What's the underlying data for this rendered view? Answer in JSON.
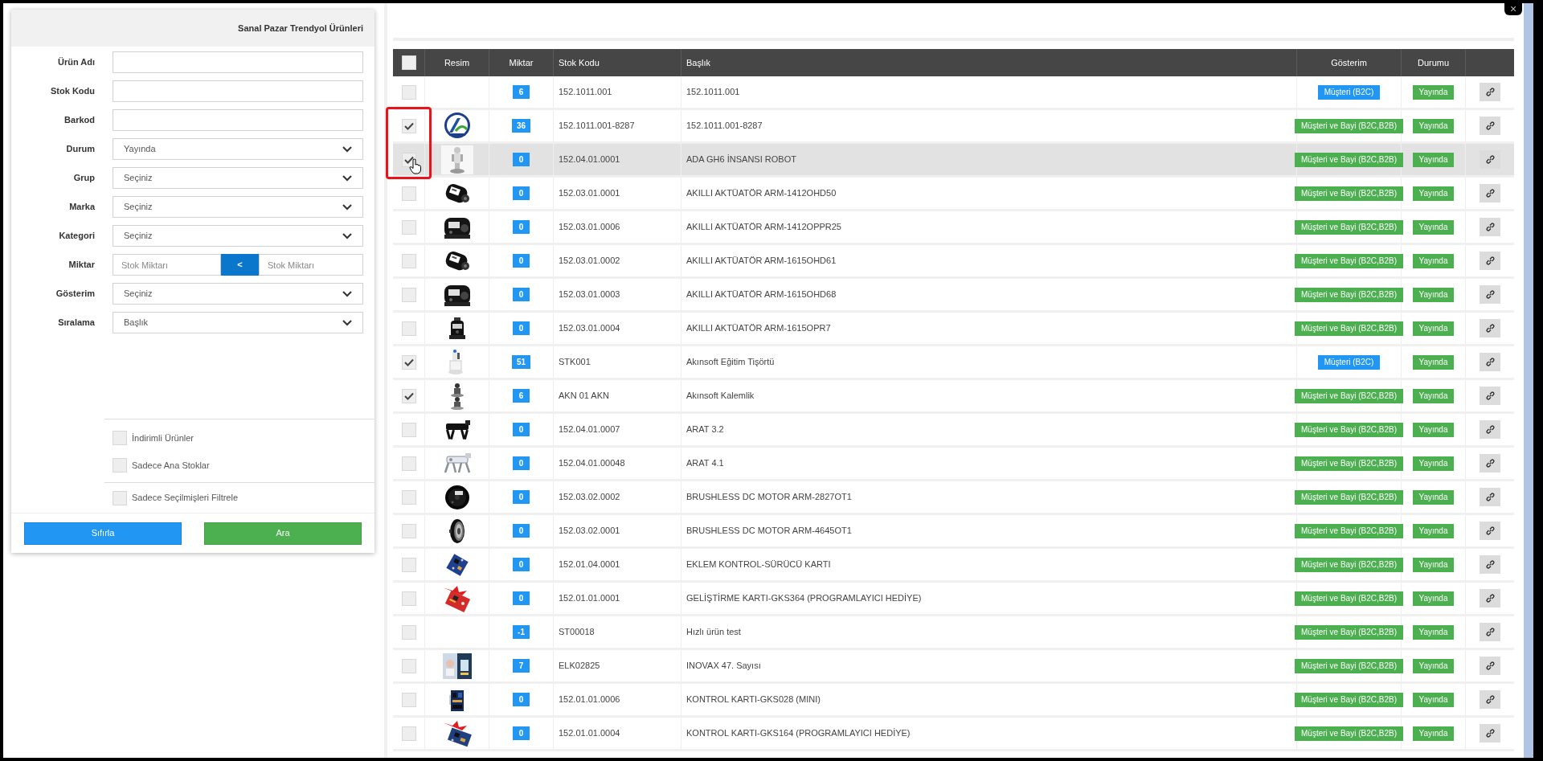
{
  "close_button": "×",
  "filter_panel": {
    "title": "Sanal Pazar Trendyol Ürünleri",
    "fields": [
      {
        "kind": "text",
        "label": "Ürün Adı"
      },
      {
        "kind": "text",
        "label": "Stok Kodu"
      },
      {
        "kind": "text",
        "label": "Barkod"
      },
      {
        "kind": "select",
        "label": "Durum",
        "value": "Yayında"
      },
      {
        "kind": "select",
        "label": "Grup",
        "value": "Seçiniz"
      },
      {
        "kind": "select",
        "label": "Marka",
        "value": "Seçiniz"
      },
      {
        "kind": "select",
        "label": "Kategori",
        "value": "Seçiniz"
      },
      {
        "kind": "range",
        "label": "Miktar",
        "placeholder_from": "Stok Miktarı",
        "operator": "<",
        "placeholder_to": "Stok Miktarı"
      },
      {
        "kind": "select",
        "label": "Gösterim",
        "value": "Seçiniz"
      },
      {
        "kind": "select",
        "label": "Sıralama",
        "value": "Başlık"
      }
    ],
    "options": [
      {
        "label": "İndirimli Ürünler",
        "checked": false
      },
      {
        "label": "Sadece Ana Stoklar",
        "checked": false
      }
    ],
    "selected_filter": {
      "label": "Sadece Seçilmişleri Filtrele",
      "checked": false
    },
    "buttons": [
      {
        "label": "Sıfırla",
        "color": "#2196f3"
      },
      {
        "label": "Ara",
        "color": "#4caf50"
      }
    ]
  },
  "table": {
    "select_all": {
      "checked": false
    },
    "columns": [
      "Resim",
      "Miktar",
      "Stok Kodu",
      "Başlık",
      "Gösterim",
      "Durumu"
    ],
    "rows": [
      {
        "checked": false,
        "hovered": false,
        "highlighted": false,
        "qty": "6",
        "code": "152.1011.001",
        "title": "152.1011.001",
        "display": "Müşteri (B2C)",
        "color": "#2196f3",
        "status": "Yayında"
      },
      {
        "checked": true,
        "hovered": false,
        "highlighted": true,
        "qty": "36",
        "code": "152.1011.001-8287",
        "title": "152.1011.001-8287",
        "display": "Müşteri ve Bayi (B2C,B2B)",
        "color": "#4caf50",
        "status": "Yayında"
      },
      {
        "checked": true,
        "hovered": true,
        "highlighted": true,
        "qty": "0",
        "code": "152.04.01.0001",
        "title": "ADA GH6 İNSANSI ROBOT",
        "display": "Müşteri ve Bayi (B2C,B2B)",
        "color": "#4caf50",
        "status": "Yayında"
      },
      {
        "checked": false,
        "hovered": false,
        "highlighted": false,
        "qty": "0",
        "code": "152.03.01.0001",
        "title": "AKILLI AKTÜATÖR ARM-1412OHD50",
        "display": "Müşteri ve Bayi (B2C,B2B)",
        "color": "#4caf50",
        "status": "Yayında"
      },
      {
        "checked": false,
        "hovered": false,
        "highlighted": false,
        "qty": "0",
        "code": "152.03.01.0006",
        "title": "AKILLI AKTÜATÖR ARM-1412OPPR25",
        "display": "Müşteri ve Bayi (B2C,B2B)",
        "color": "#4caf50",
        "status": "Yayında"
      },
      {
        "checked": false,
        "hovered": false,
        "highlighted": false,
        "qty": "0",
        "code": "152.03.01.0002",
        "title": "AKILLI AKTÜATÖR ARM-1615OHD61",
        "display": "Müşteri ve Bayi (B2C,B2B)",
        "color": "#4caf50",
        "status": "Yayında"
      },
      {
        "checked": false,
        "hovered": false,
        "highlighted": false,
        "qty": "0",
        "code": "152.03.01.0003",
        "title": "AKILLI AKTÜATÖR ARM-1615OHD68",
        "display": "Müşteri ve Bayi (B2C,B2B)",
        "color": "#4caf50",
        "status": "Yayında"
      },
      {
        "checked": false,
        "hovered": false,
        "highlighted": false,
        "qty": "0",
        "code": "152.03.01.0004",
        "title": "AKILLI AKTÜATÖR ARM-1615OPR7",
        "display": "Müşteri ve Bayi (B2C,B2B)",
        "color": "#4caf50",
        "status": "Yayında"
      },
      {
        "checked": true,
        "hovered": false,
        "highlighted": false,
        "qty": "51",
        "code": "STK001",
        "title": "Akınsoft Eğitim Tişörtü",
        "display": "Müşteri (B2C)",
        "color": "#2196f3",
        "status": "Yayında"
      },
      {
        "checked": true,
        "hovered": false,
        "highlighted": false,
        "qty": "6",
        "code": "AKN 01 AKN",
        "title": "Akınsoft Kalemlik",
        "display": "Müşteri ve Bayi (B2C,B2B)",
        "color": "#4caf50",
        "status": "Yayında"
      },
      {
        "checked": false,
        "hovered": false,
        "highlighted": false,
        "qty": "0",
        "code": "152.04.01.0007",
        "title": "ARAT 3.2",
        "display": "Müşteri ve Bayi (B2C,B2B)",
        "color": "#4caf50",
        "status": "Yayında"
      },
      {
        "checked": false,
        "hovered": false,
        "highlighted": false,
        "qty": "0",
        "code": "152.04.01.00048",
        "title": "ARAT 4.1",
        "display": "Müşteri ve Bayi (B2C,B2B)",
        "color": "#4caf50",
        "status": "Yayında"
      },
      {
        "checked": false,
        "hovered": false,
        "highlighted": false,
        "qty": "0",
        "code": "152.03.02.0002",
        "title": "BRUSHLESS DC MOTOR ARM-2827OT1",
        "display": "Müşteri ve Bayi (B2C,B2B)",
        "color": "#4caf50",
        "status": "Yayında"
      },
      {
        "checked": false,
        "hovered": false,
        "highlighted": false,
        "qty": "0",
        "code": "152.03.02.0001",
        "title": "BRUSHLESS DC MOTOR ARM-4645OT1",
        "display": "Müşteri ve Bayi (B2C,B2B)",
        "color": "#4caf50",
        "status": "Yayında"
      },
      {
        "checked": false,
        "hovered": false,
        "highlighted": false,
        "qty": "0",
        "code": "152.01.04.0001",
        "title": "EKLEM KONTROL-SÜRÜCÜ KARTI",
        "display": "Müşteri ve Bayi (B2C,B2B)",
        "color": "#4caf50",
        "status": "Yayında"
      },
      {
        "checked": false,
        "hovered": false,
        "highlighted": false,
        "qty": "0",
        "code": "152.01.01.0001",
        "title": "GELİŞTİRME KARTI-GKS364 (PROGRAMLAYICI HEDİYE)",
        "display": "Müşteri ve Bayi (B2C,B2B)",
        "color": "#4caf50",
        "status": "Yayında"
      },
      {
        "checked": false,
        "hovered": false,
        "highlighted": false,
        "qty": "-1",
        "code": "ST00018",
        "title": "Hızlı ürün test",
        "display": "Müşteri ve Bayi (B2C,B2B)",
        "color": "#4caf50",
        "status": "Yayında"
      },
      {
        "checked": false,
        "hovered": false,
        "highlighted": false,
        "qty": "7",
        "code": "ELK02825",
        "title": "INOVAX 47. Sayısı",
        "display": "Müşteri ve Bayi (B2C,B2B)",
        "color": "#4caf50",
        "status": "Yayında"
      },
      {
        "checked": false,
        "hovered": false,
        "highlighted": false,
        "qty": "0",
        "code": "152.01.01.0006",
        "title": "KONTROL KARTI-GKS028 (MINI)",
        "display": "Müşteri ve Bayi (B2C,B2B)",
        "color": "#4caf50",
        "status": "Yayında"
      },
      {
        "checked": false,
        "hovered": false,
        "highlighted": false,
        "qty": "0",
        "code": "152.01.01.0004",
        "title": "KONTROL KARTI-GKS164 (PROGRAMLAYICI HEDİYE)",
        "display": "Müşteri ve Bayi (B2C,B2B)",
        "color": "#4caf50",
        "status": "Yayında"
      }
    ]
  }
}
